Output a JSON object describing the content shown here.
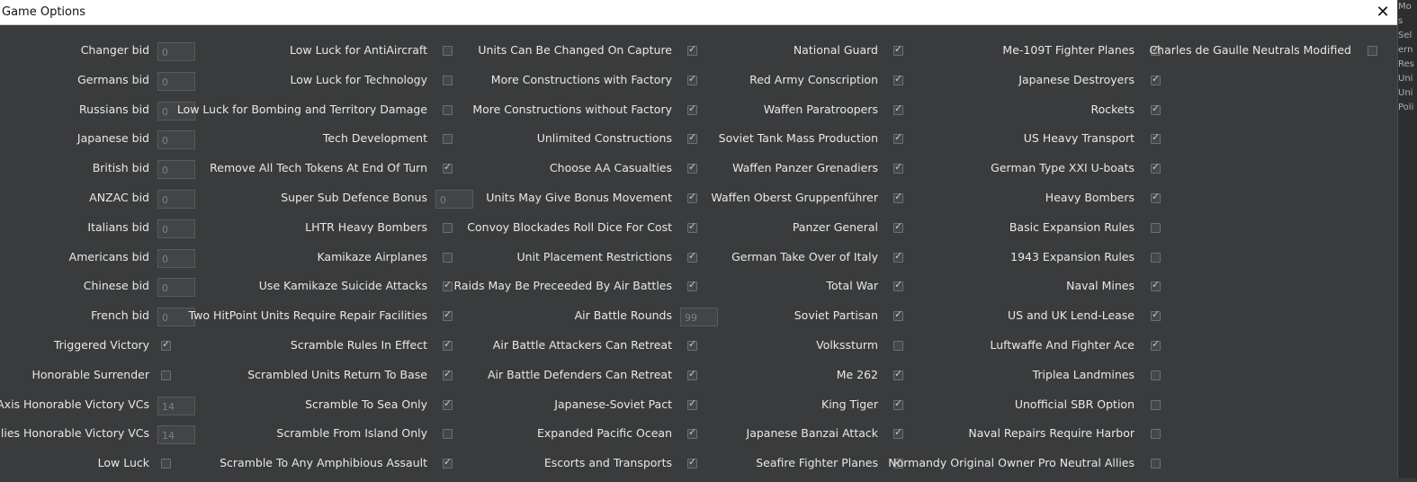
{
  "window": {
    "title": "Game Options"
  },
  "edge_texts": [
    "Mo",
    "s",
    "Sel",
    "ern",
    "Res",
    "Uni",
    "Uni",
    "Poli"
  ],
  "columns": [
    [
      {
        "label": "Changer bid",
        "type": "number",
        "value": "0"
      },
      {
        "label": "Germans bid",
        "type": "number",
        "value": "0"
      },
      {
        "label": "Russians bid",
        "type": "number",
        "value": "0"
      },
      {
        "label": "Japanese bid",
        "type": "number",
        "value": "0"
      },
      {
        "label": "British bid",
        "type": "number",
        "value": "0"
      },
      {
        "label": "ANZAC bid",
        "type": "number",
        "value": "0"
      },
      {
        "label": "Italians bid",
        "type": "number",
        "value": "0"
      },
      {
        "label": "Americans bid",
        "type": "number",
        "value": "0"
      },
      {
        "label": "Chinese bid",
        "type": "number",
        "value": "0"
      },
      {
        "label": "French bid",
        "type": "number",
        "value": "0"
      },
      {
        "label": "Triggered Victory",
        "type": "check",
        "value": true
      },
      {
        "label": "Honorable Surrender",
        "type": "check",
        "value": false
      },
      {
        "label": "Axis Honorable Victory VCs",
        "type": "number",
        "value": "14"
      },
      {
        "label": "Allies Honorable Victory VCs",
        "type": "number",
        "value": "14"
      },
      {
        "label": "Low Luck",
        "type": "check",
        "value": false
      }
    ],
    [
      {
        "label": "Low Luck for AntiAircraft",
        "type": "check",
        "value": false
      },
      {
        "label": "Low Luck for Technology",
        "type": "check",
        "value": false
      },
      {
        "label": "Low Luck for Bombing and Territory Damage",
        "type": "check",
        "value": false
      },
      {
        "label": "Tech Development",
        "type": "check",
        "value": false
      },
      {
        "label": "Remove All Tech Tokens At End Of Turn",
        "type": "check",
        "value": true
      },
      {
        "label": "Super Sub Defence Bonus",
        "type": "number",
        "value": "0"
      },
      {
        "label": "LHTR Heavy Bombers",
        "type": "check",
        "value": false
      },
      {
        "label": "Kamikaze Airplanes",
        "type": "check",
        "value": false
      },
      {
        "label": "Use Kamikaze Suicide Attacks",
        "type": "check",
        "value": true
      },
      {
        "label": "Two HitPoint Units Require Repair Facilities",
        "type": "check",
        "value": true
      },
      {
        "label": "Scramble Rules In Effect",
        "type": "check",
        "value": true
      },
      {
        "label": "Scrambled Units Return To Base",
        "type": "check",
        "value": true
      },
      {
        "label": "Scramble To Sea Only",
        "type": "check",
        "value": true
      },
      {
        "label": "Scramble From Island Only",
        "type": "check",
        "value": false
      },
      {
        "label": "Scramble To Any Amphibious Assault",
        "type": "check",
        "value": true
      }
    ],
    [
      {
        "label": "Units Can Be Changed On Capture",
        "type": "check",
        "value": true
      },
      {
        "label": "More Constructions with Factory",
        "type": "check",
        "value": true
      },
      {
        "label": "More Constructions without Factory",
        "type": "check",
        "value": true
      },
      {
        "label": "Unlimited Constructions",
        "type": "check",
        "value": true
      },
      {
        "label": "Choose AA Casualties",
        "type": "check",
        "value": true
      },
      {
        "label": "Units May Give Bonus Movement",
        "type": "check",
        "value": true
      },
      {
        "label": "Convoy Blockades Roll Dice For Cost",
        "type": "check",
        "value": true
      },
      {
        "label": "Unit Placement Restrictions",
        "type": "check",
        "value": true
      },
      {
        "label": "Raids May Be Preceeded By Air Battles",
        "type": "check",
        "value": true
      },
      {
        "label": "Air Battle Rounds",
        "type": "number",
        "value": "99"
      },
      {
        "label": "Air Battle Attackers Can Retreat",
        "type": "check",
        "value": true
      },
      {
        "label": "Air Battle Defenders Can Retreat",
        "type": "check",
        "value": true
      },
      {
        "label": "Japanese-Soviet Pact",
        "type": "check",
        "value": true
      },
      {
        "label": "Expanded Pacific Ocean",
        "type": "check",
        "value": true
      },
      {
        "label": "Escorts and Transports",
        "type": "check",
        "value": true
      }
    ],
    [
      {
        "label": "National Guard",
        "type": "check",
        "value": true
      },
      {
        "label": "Red Army Conscription",
        "type": "check",
        "value": true
      },
      {
        "label": "Waffen Paratroopers",
        "type": "check",
        "value": true
      },
      {
        "label": "Soviet Tank Mass Production",
        "type": "check",
        "value": true
      },
      {
        "label": "Waffen Panzer Grenadiers",
        "type": "check",
        "value": true
      },
      {
        "label": "Waffen Oberst Gruppenführer",
        "type": "check",
        "value": true
      },
      {
        "label": "Panzer General",
        "type": "check",
        "value": true
      },
      {
        "label": "German Take Over of Italy",
        "type": "check",
        "value": true
      },
      {
        "label": "Total War",
        "type": "check",
        "value": true
      },
      {
        "label": "Soviet Partisan",
        "type": "check",
        "value": true
      },
      {
        "label": "Volkssturm",
        "type": "check",
        "value": false
      },
      {
        "label": "Me 262",
        "type": "check",
        "value": true
      },
      {
        "label": "King Tiger",
        "type": "check",
        "value": true
      },
      {
        "label": "Japanese Banzai Attack",
        "type": "check",
        "value": true
      },
      {
        "label": "Seafire Fighter Planes",
        "type": "check",
        "value": true
      }
    ],
    [
      {
        "label": "Me-109T Fighter Planes",
        "type": "check",
        "value": true
      },
      {
        "label": "Japanese Destroyers",
        "type": "check",
        "value": true
      },
      {
        "label": "Rockets",
        "type": "check",
        "value": true
      },
      {
        "label": "US Heavy Transport",
        "type": "check",
        "value": true
      },
      {
        "label": "German Type XXI U-boats",
        "type": "check",
        "value": true
      },
      {
        "label": "Heavy Bombers",
        "type": "check",
        "value": true
      },
      {
        "label": "Basic Expansion Rules",
        "type": "check",
        "value": false
      },
      {
        "label": "1943 Expansion Rules",
        "type": "check",
        "value": false
      },
      {
        "label": "Naval Mines",
        "type": "check",
        "value": true
      },
      {
        "label": "US and UK Lend-Lease",
        "type": "check",
        "value": true
      },
      {
        "label": "Luftwaffe And Fighter Ace",
        "type": "check",
        "value": true
      },
      {
        "label": "Triplea Landmines",
        "type": "check",
        "value": false
      },
      {
        "label": "Unofficial SBR Option",
        "type": "check",
        "value": false
      },
      {
        "label": "Naval Repairs Require Harbor",
        "type": "check",
        "value": false
      },
      {
        "label": "Normandy Original Owner Pro Neutral Allies",
        "type": "check",
        "value": false
      }
    ],
    [
      {
        "label": "Charles de Gaulle Neutrals Modified",
        "type": "check",
        "value": false
      }
    ]
  ]
}
